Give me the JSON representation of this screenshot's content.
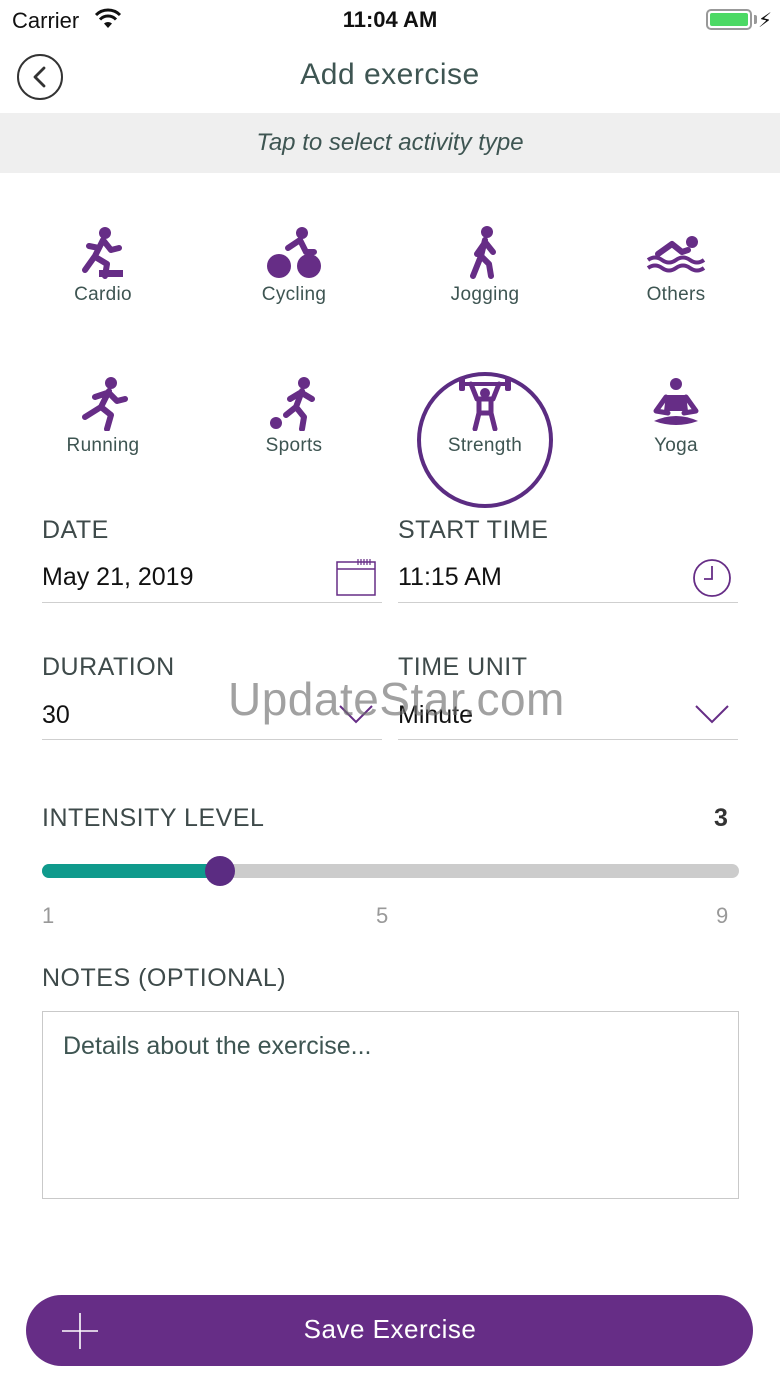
{
  "status_bar": {
    "carrier": "Carrier",
    "time": "11:04 AM"
  },
  "header": {
    "title": "Add exercise"
  },
  "hint": "Tap to select activity type",
  "activities": [
    {
      "label": "Cardio",
      "icon": "cardio-icon",
      "selected": false
    },
    {
      "label": "Cycling",
      "icon": "cycling-icon",
      "selected": false
    },
    {
      "label": "Jogging",
      "icon": "jogging-icon",
      "selected": false
    },
    {
      "label": "Others",
      "icon": "swimming-icon",
      "selected": false
    },
    {
      "label": "Running",
      "icon": "running-icon",
      "selected": false
    },
    {
      "label": "Sports",
      "icon": "sports-icon",
      "selected": false
    },
    {
      "label": "Strength",
      "icon": "weightlifting-icon",
      "selected": true
    },
    {
      "label": "Yoga",
      "icon": "yoga-icon",
      "selected": false
    }
  ],
  "form": {
    "date_label": "DATE",
    "date_value": "May 21, 2019",
    "start_time_label": "START TIME",
    "start_time_value": "11:15 AM",
    "duration_label": "DURATION",
    "duration_value": "30",
    "time_unit_label": "TIME UNIT",
    "time_unit_value": "Minute"
  },
  "intensity": {
    "label": "INTENSITY LEVEL",
    "value": "3",
    "min": 1,
    "max": 9,
    "tick_min": "1",
    "tick_mid": "5",
    "tick_max": "9"
  },
  "notes": {
    "label": "NOTES (OPTIONAL)",
    "placeholder": "Details about the exercise..."
  },
  "save_button": {
    "label": "Save Exercise"
  },
  "watermark": "UpdateStar.com",
  "colors": {
    "accent": "#662d86",
    "slider_fill": "#0f9a8c",
    "text": "#3e5552"
  }
}
